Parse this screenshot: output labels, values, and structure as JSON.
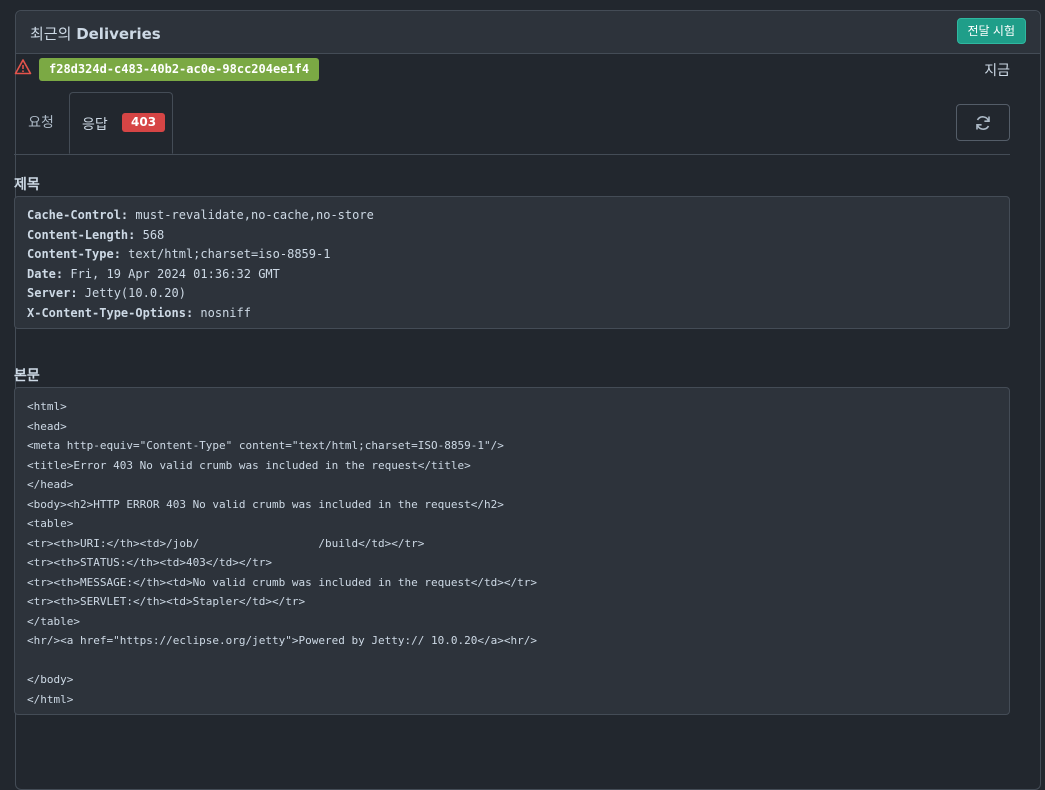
{
  "panel": {
    "title_prefix": "최근의",
    "title_main": "Deliveries",
    "redeliver_label": "전달 시험"
  },
  "delivery": {
    "guid": "f28d324d-c483-40b2-ac0e-98cc204ee1f4",
    "time": "지금",
    "warning_icon": "warning-triangle-icon"
  },
  "tabs": {
    "request_label": "요청",
    "response_label": "응답",
    "status_code": "403",
    "refresh_icon": "refresh-icon"
  },
  "headers": {
    "title": "제목",
    "items": [
      {
        "key": "Cache-Control:",
        "value": " must-revalidate,no-cache,no-store"
      },
      {
        "key": "Content-Length:",
        "value": " 568"
      },
      {
        "key": "Content-Type:",
        "value": " text/html;charset=iso-8859-1"
      },
      {
        "key": "Date:",
        "value": " Fri, 19 Apr 2024 01:36:32 GMT"
      },
      {
        "key": "Server:",
        "value": " Jetty(10.0.20)"
      },
      {
        "key": "X-Content-Type-Options:",
        "value": " nosniff"
      }
    ]
  },
  "body": {
    "title": "본문",
    "lines": [
      "<html>",
      "<head>",
      "<meta http-equiv=\"Content-Type\" content=\"text/html;charset=ISO-8859-1\"/>",
      "<title>Error 403 No valid crumb was included in the request</title>",
      "</head>",
      "<body><h2>HTTP ERROR 403 No valid crumb was included in the request</h2>",
      "<table>",
      "<tr><th>URI:</th><td>/job/                  /build</td></tr>",
      "<tr><th>STATUS:</th><td>403</td></tr>",
      "<tr><th>MESSAGE:</th><td>No valid crumb was included in the request</td></tr>",
      "<tr><th>SERVLET:</th><td>Stapler</td></tr>",
      "</table>",
      "<hr/><a href=\"https://eclipse.org/jetty\">Powered by Jetty:// 10.0.20</a><hr/>",
      "",
      "</body>",
      "</html>"
    ]
  }
}
